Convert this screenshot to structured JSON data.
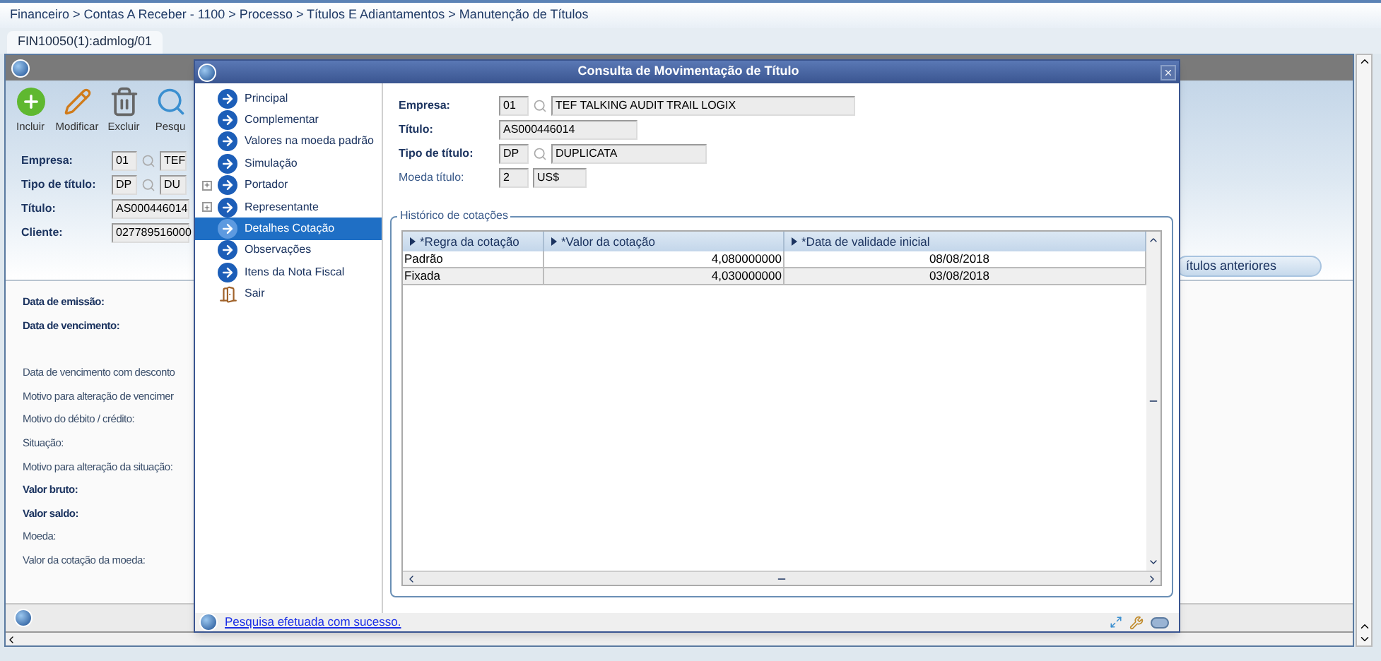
{
  "breadcrumb": "Financeiro > Contas A Receber - 1100 > Processo > Títulos E Adiantamentos > Manutenção de Títulos",
  "tabs": [
    {
      "label": "FIN10050(1):admlog/01",
      "selected": true
    }
  ],
  "toolbar": [
    {
      "label": "Incluir",
      "kind": "add"
    },
    {
      "label": "Modificar",
      "kind": "edit"
    },
    {
      "label": "Excluir",
      "kind": "delete"
    },
    {
      "label": "Pesqu",
      "kind": "search"
    }
  ],
  "background_form": [
    {
      "label": "Empresa:",
      "code": "01",
      "lookup": true,
      "description": "TEF"
    },
    {
      "label": "Tipo de título:",
      "code": "DP",
      "lookup": true,
      "description": "DU"
    },
    {
      "label": "Título:",
      "value": "AS000446014"
    },
    {
      "label": "Cliente:",
      "value": "027789516000"
    }
  ],
  "previous_titles_button": "ítulos anteriores",
  "detail_groups": [
    [
      {
        "text": "Data de emissão:",
        "bold": true
      },
      {
        "text": "Data de vencimento:",
        "bold": true
      }
    ],
    [
      {
        "text": "Data de vencimento com desconto",
        "bold": false
      },
      {
        "text": "Motivo para alteração de vencimer",
        "bold": false
      },
      {
        "text": "Motivo do débito / crédito:",
        "bold": false
      },
      {
        "text": "Situação:",
        "bold": false
      },
      {
        "text": "Motivo para alteração da situação:",
        "bold": false
      },
      {
        "text": "Valor bruto:",
        "bold": true
      },
      {
        "text": "Valor saldo:",
        "bold": true
      },
      {
        "text": "Moeda:",
        "bold": false
      },
      {
        "text": "Valor da cotação da moeda:",
        "bold": false
      }
    ]
  ],
  "modal": {
    "title": "Consulta de Movimentação de Título",
    "tree": [
      {
        "label": "Principal",
        "kind": "leaf",
        "selected": false
      },
      {
        "label": "Complementar",
        "kind": "leaf",
        "selected": false
      },
      {
        "label": "Valores na moeda padrão",
        "kind": "leaf",
        "selected": false
      },
      {
        "label": "Simulação",
        "kind": "leaf",
        "selected": false
      },
      {
        "label": "Portador",
        "kind": "group",
        "selected": false
      },
      {
        "label": "Representante",
        "kind": "group",
        "selected": false
      },
      {
        "label": "Detalhes Cotação",
        "kind": "leaf",
        "selected": true
      },
      {
        "label": "Observações",
        "kind": "leaf",
        "selected": false
      },
      {
        "label": "Itens da Nota Fiscal",
        "kind": "leaf",
        "selected": false
      },
      {
        "label": "Sair",
        "kind": "exit",
        "selected": false
      }
    ],
    "fields": [
      {
        "label": "Empresa:",
        "bold": true,
        "code": "01",
        "lookup": true,
        "description": "TEF TALKING AUDIT TRAIL LOGIX"
      },
      {
        "label": "Título:",
        "bold": true,
        "value": "AS000446014"
      },
      {
        "label": "Tipo de título:",
        "bold": true,
        "code": "DP",
        "lookup": true,
        "description": "DUPLICATA"
      },
      {
        "label": "Moeda título:",
        "bold": false,
        "code": "2",
        "lookup": false,
        "description": "US$"
      }
    ],
    "history": {
      "title": "Histórico de cotações",
      "columns": [
        "*Regra da cotação",
        "*Valor da cotação",
        "*Data de validade inicial"
      ],
      "rows": [
        [
          "Padrão",
          "4,080000000",
          "08/08/2018"
        ],
        [
          "Fixada",
          "4,030000000",
          "03/08/2018"
        ]
      ]
    },
    "status": "Pesquisa efetuada com sucesso."
  }
}
